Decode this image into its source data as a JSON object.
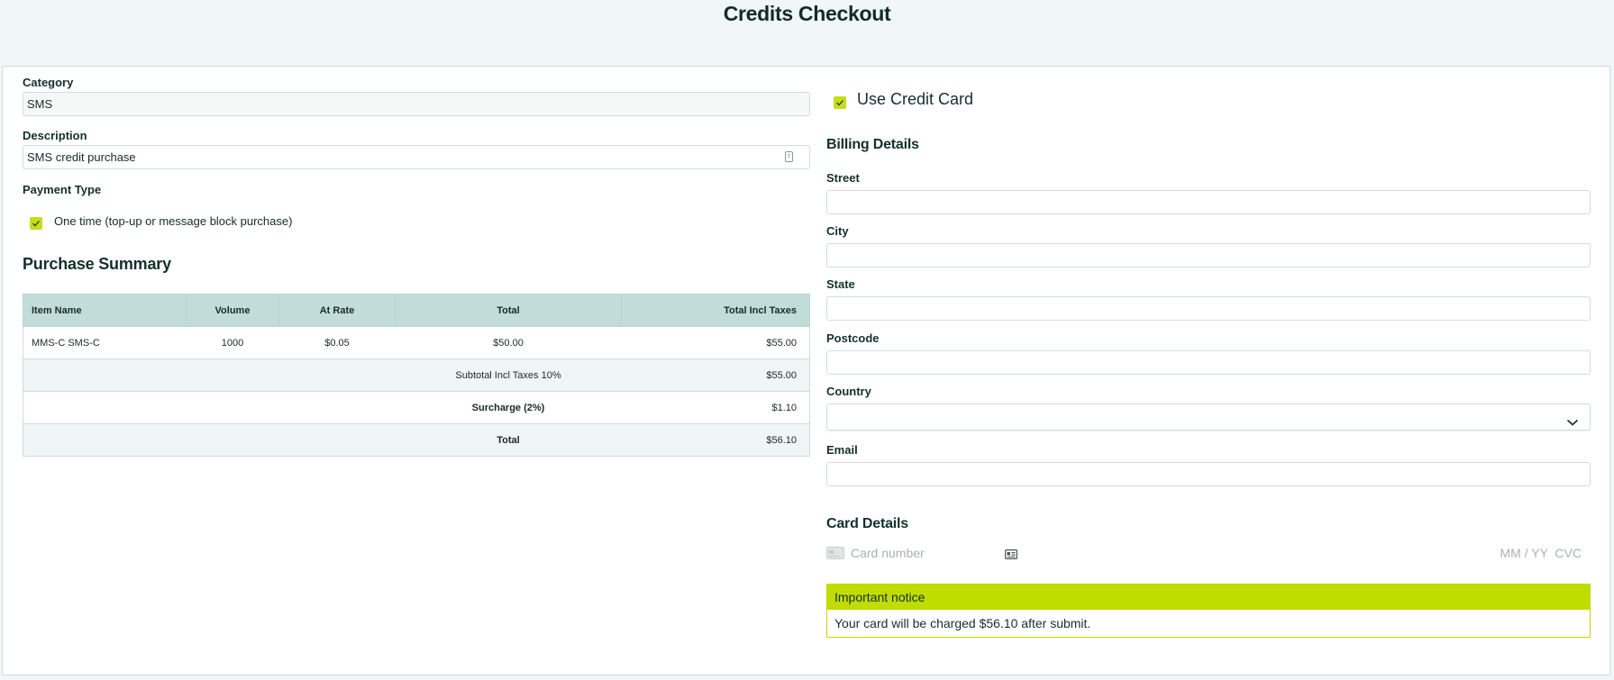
{
  "page": {
    "title": "Credits Checkout"
  },
  "form": {
    "category": {
      "label": "Category",
      "value": "SMS"
    },
    "description": {
      "label": "Description",
      "value": "SMS credit purchase"
    },
    "payment_type": {
      "label": "Payment Type",
      "option_label": "One time (top-up or message block purchase)",
      "checked": true
    }
  },
  "summary": {
    "title": "Purchase Summary",
    "headers": [
      "Item Name",
      "Volume",
      "At Rate",
      "Total",
      "Total Incl Taxes"
    ],
    "item": {
      "name": "MMS-C SMS-C",
      "volume": "1000",
      "rate": "$0.05",
      "total": "$50.00",
      "total_incl": "$55.00"
    },
    "subtotal": {
      "label": "Subtotal Incl Taxes 10%",
      "value": "$55.00"
    },
    "surcharge": {
      "label": "Surcharge (2%)",
      "value": "$1.10"
    },
    "grand_total": {
      "label": "Total",
      "value": "$56.10"
    }
  },
  "payment": {
    "use_credit_card_label": "Use Credit Card",
    "use_credit_card_checked": true
  },
  "billing": {
    "title": "Billing Details",
    "street_label": "Street",
    "street_value": "",
    "city_label": "City",
    "city_value": "",
    "state_label": "State",
    "state_value": "",
    "postcode_label": "Postcode",
    "postcode_value": "",
    "country_label": "Country",
    "country_value": "",
    "email_label": "Email",
    "email_value": ""
  },
  "card": {
    "title": "Card Details",
    "number_placeholder": "Card number",
    "expiry_cvc_placeholder": "MM / YY  CVC"
  },
  "notice": {
    "title": "Important notice",
    "message": "Your card will be charged $56.10 after submit."
  },
  "colors": {
    "accent": "#c0dc00",
    "table_header": "#c2ddd9",
    "background": "#f1f6f6"
  }
}
